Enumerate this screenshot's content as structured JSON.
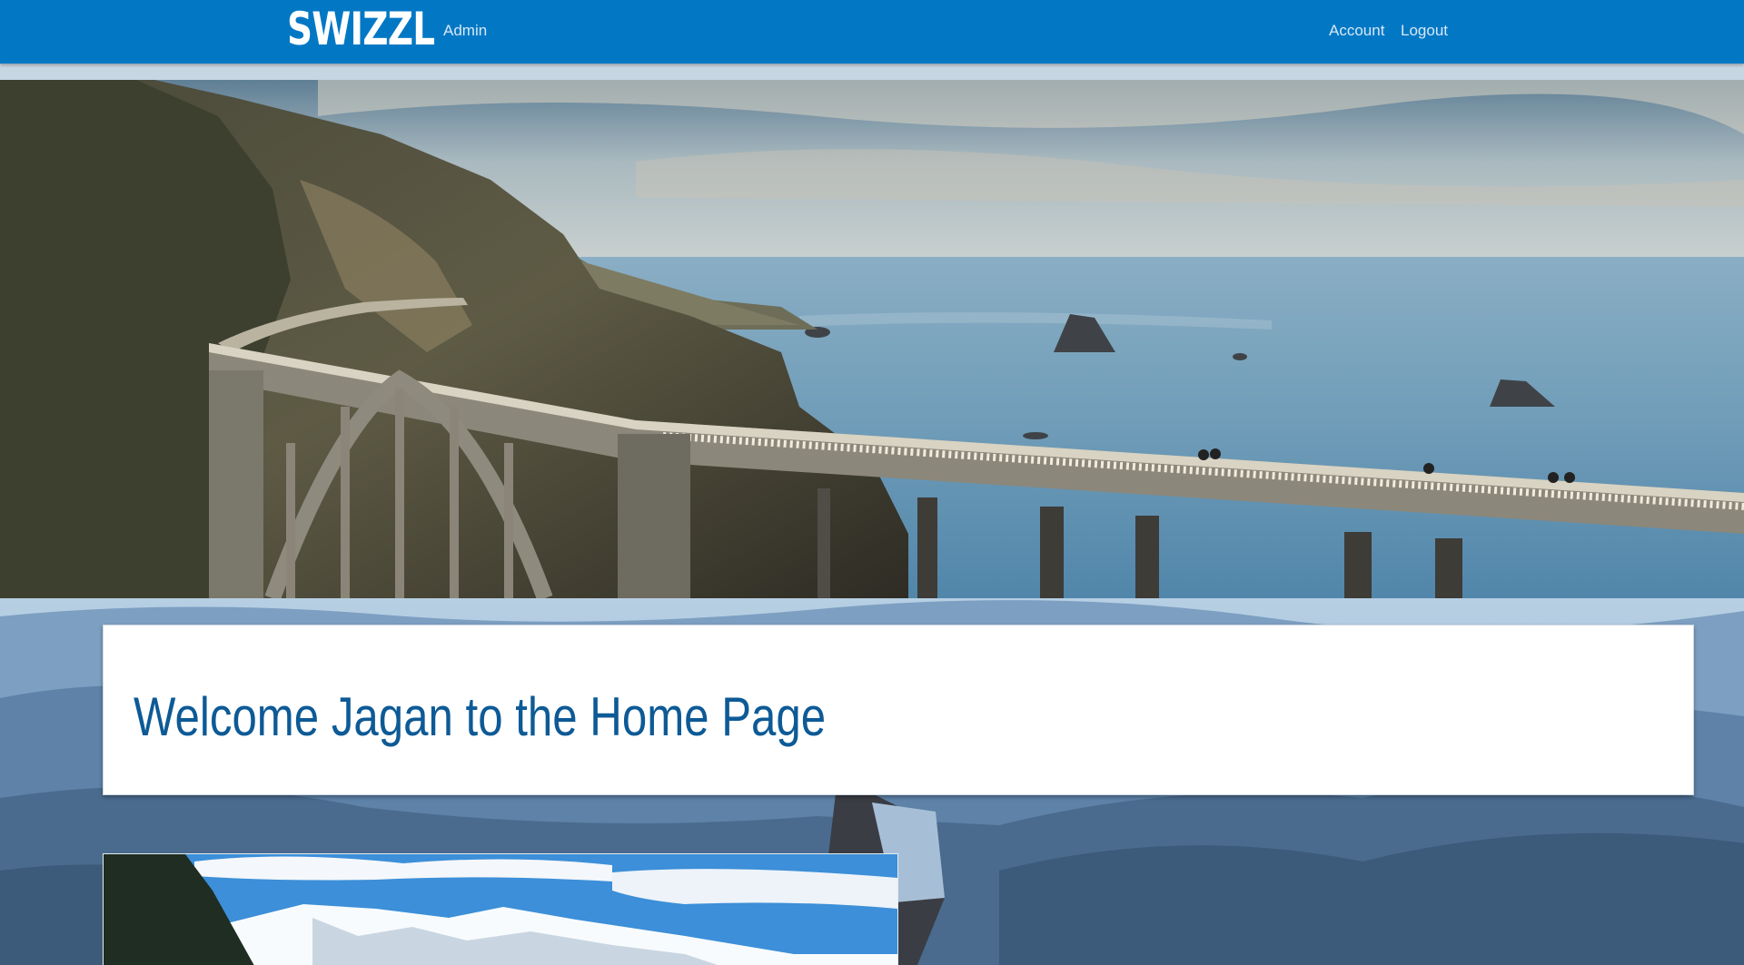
{
  "navbar": {
    "brand": "SWIZZL",
    "links": {
      "admin": "Admin",
      "account": "Account",
      "logout": "Logout"
    },
    "colors": {
      "background": "#0278c5",
      "brand_text": "#ffffff",
      "link_text": "#d8e8f5"
    }
  },
  "hero": {
    "image_icon": "coastal-bridge-photo"
  },
  "welcome": {
    "title": "Welcome Jagan to the Home Page",
    "title_color": "#0d5a96"
  },
  "feature_card": {
    "image_icon": "snowy-mountain-photo"
  },
  "background": {
    "image_icon": "hiker-mountain-photo"
  }
}
